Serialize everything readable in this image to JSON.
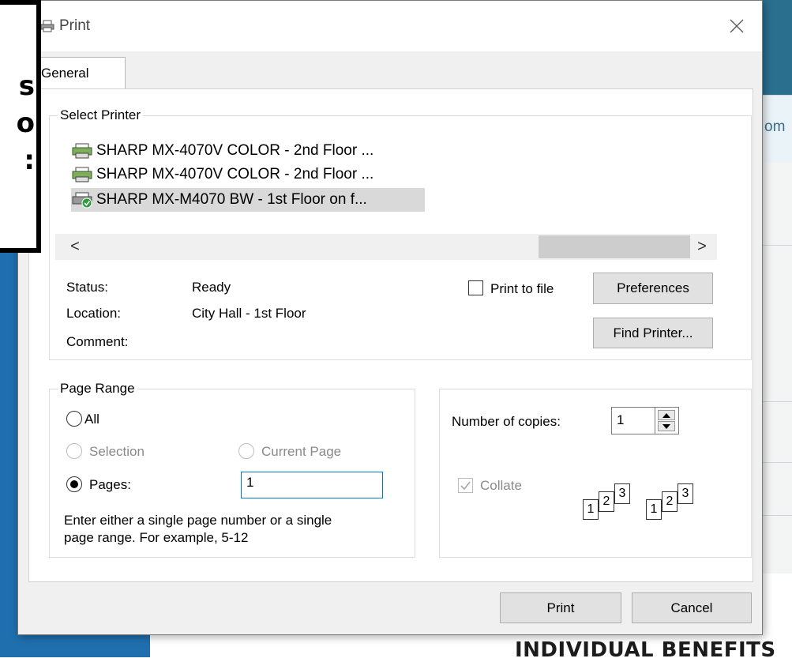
{
  "background": {
    "partial_tab_text": "om",
    "heading_fragment": "INDIVIDUAL BENEFITS"
  },
  "callout": {
    "lines": [
      "s",
      "o",
      ":"
    ]
  },
  "dialog": {
    "title": "Print",
    "tab": "General",
    "select_printer": {
      "label": "Select Printer",
      "printers": [
        {
          "name": "SHARP MX-4070V COLOR - 2nd Floor ...",
          "icon": "printer-icon",
          "selected": false
        },
        {
          "name": "SHARP MX-4070V COLOR - 2nd Floor ...",
          "icon": "printer-icon",
          "selected": false
        },
        {
          "name": "SHARP MX-M4070 BW - 1st Floor on f...",
          "icon": "default-printer-icon",
          "selected": true
        }
      ],
      "scroll_left": "<",
      "scroll_right": ">",
      "status_label": "Status:",
      "status_value": "Ready",
      "location_label": "Location:",
      "location_value": "City Hall - 1st Floor",
      "comment_label": "Comment:",
      "comment_value": "",
      "print_to_file_label": "Print to file",
      "print_to_file_checked": false,
      "preferences_button": "Preferences",
      "find_printer_button": "Find Printer..."
    },
    "page_range": {
      "label": "Page Range",
      "all_label": "All",
      "selection_label": "Selection",
      "current_page_label": "Current Page",
      "pages_label": "Pages:",
      "pages_value": "1",
      "selected": "Pages",
      "help_text_line1": "Enter either a single page number or a single",
      "help_text_line2": "page range.  For example, 5-12"
    },
    "copies": {
      "label": "Number of copies:",
      "value": "1",
      "collate_label": "Collate",
      "collate_checked": true,
      "collate_pages": [
        "1",
        "2",
        "3",
        "1",
        "2",
        "3"
      ]
    },
    "print_button": "Print",
    "cancel_button": "Cancel"
  },
  "colors": {
    "accent": "#0078d7",
    "selection": "#d9d9d9",
    "background_blue": "#1f6fae"
  }
}
